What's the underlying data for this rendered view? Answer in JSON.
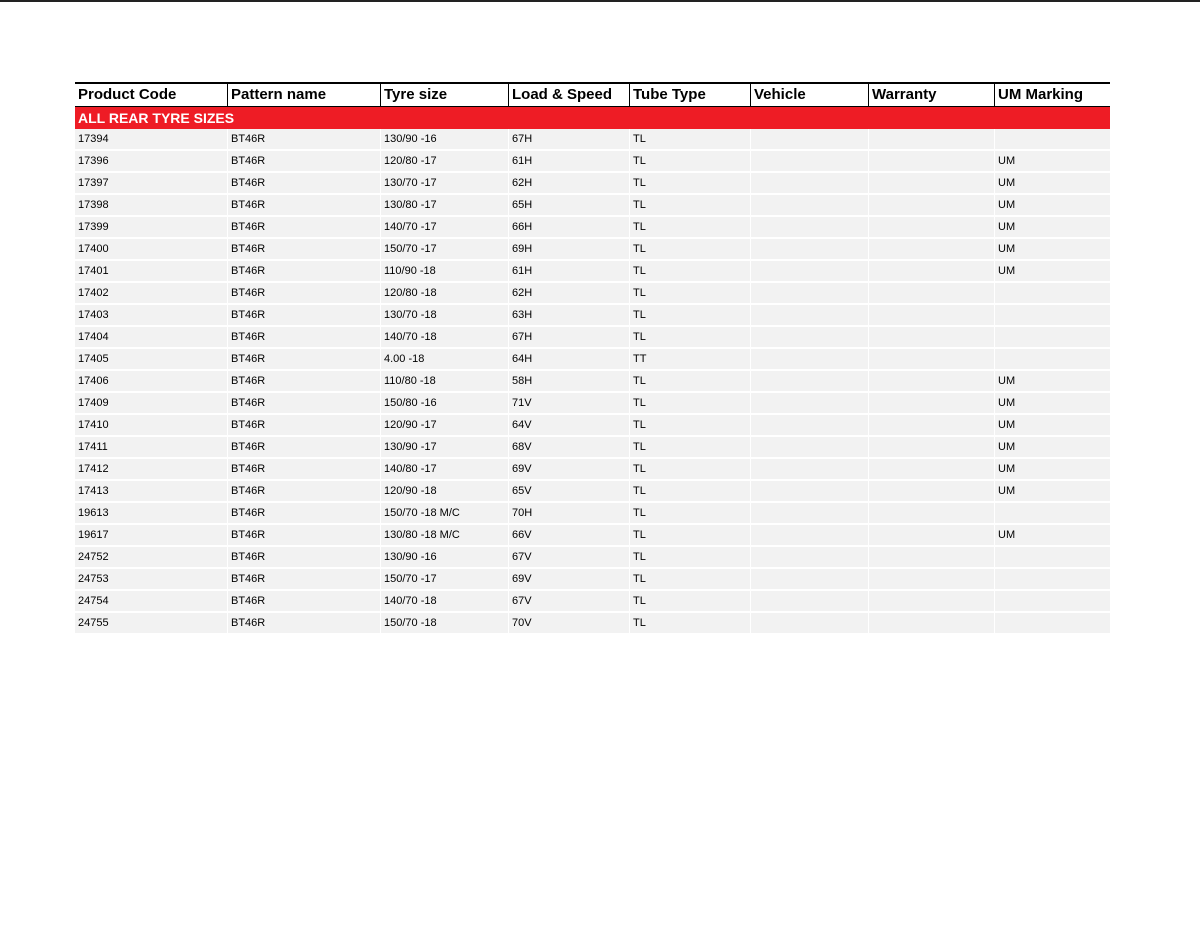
{
  "table": {
    "headers": [
      "Product Code",
      "Pattern name",
      "Tyre size",
      "Load & Speed",
      "Tube Type",
      "Vehicle",
      "Warranty",
      "UM Marking"
    ],
    "section_label": "ALL REAR TYRE SIZES",
    "rows": [
      [
        "17394",
        "BT46R",
        "130/90 -16",
        "67H",
        "TL",
        "",
        "",
        ""
      ],
      [
        "17396",
        "BT46R",
        "120/80 -17",
        "61H",
        "TL",
        "",
        "",
        "UM"
      ],
      [
        "17397",
        "BT46R",
        "130/70 -17",
        "62H",
        "TL",
        "",
        "",
        "UM"
      ],
      [
        "17398",
        "BT46R",
        "130/80 -17",
        "65H",
        "TL",
        "",
        "",
        "UM"
      ],
      [
        "17399",
        "BT46R",
        "140/70 -17",
        "66H",
        "TL",
        "",
        "",
        "UM"
      ],
      [
        "17400",
        "BT46R",
        "150/70 -17",
        "69H",
        "TL",
        "",
        "",
        "UM"
      ],
      [
        "17401",
        "BT46R",
        "110/90 -18",
        "61H",
        "TL",
        "",
        "",
        "UM"
      ],
      [
        "17402",
        "BT46R",
        "120/80 -18",
        "62H",
        "TL",
        "",
        "",
        ""
      ],
      [
        "17403",
        "BT46R",
        "130/70 -18",
        "63H",
        "TL",
        "",
        "",
        ""
      ],
      [
        "17404",
        "BT46R",
        "140/70 -18",
        "67H",
        "TL",
        "",
        "",
        ""
      ],
      [
        "17405",
        "BT46R",
        "4.00 -18",
        "64H",
        "TT",
        "",
        "",
        ""
      ],
      [
        "17406",
        "BT46R",
        "110/80 -18",
        "58H",
        "TL",
        "",
        "",
        "UM"
      ],
      [
        "17409",
        "BT46R",
        "150/80 -16",
        "71V",
        "TL",
        "",
        "",
        "UM"
      ],
      [
        "17410",
        "BT46R",
        "120/90 -17",
        "64V",
        "TL",
        "",
        "",
        "UM"
      ],
      [
        "17411",
        "BT46R",
        "130/90 -17",
        "68V",
        "TL",
        "",
        "",
        "UM"
      ],
      [
        "17412",
        "BT46R",
        "140/80 -17",
        "69V",
        "TL",
        "",
        "",
        "UM"
      ],
      [
        "17413",
        "BT46R",
        "120/90 -18",
        "65V",
        "TL",
        "",
        "",
        "UM"
      ],
      [
        "19613",
        "BT46R",
        "150/70 -18 M/C",
        "70H",
        "TL",
        "",
        "",
        ""
      ],
      [
        "19617",
        "BT46R",
        "130/80 -18 M/C",
        "66V",
        "TL",
        "",
        "",
        "UM"
      ],
      [
        "24752",
        "BT46R",
        "130/90 -16",
        "67V",
        "TL",
        "",
        "",
        ""
      ],
      [
        "24753",
        "BT46R",
        "150/70 -17",
        "69V",
        "TL",
        "",
        "",
        ""
      ],
      [
        "24754",
        "BT46R",
        "140/70 -18",
        "67V",
        "TL",
        "",
        "",
        ""
      ],
      [
        "24755",
        "BT46R",
        "150/70 -18",
        "70V",
        "TL",
        "",
        "",
        ""
      ]
    ]
  },
  "colors": {
    "section_bg": "#ee1c25",
    "row_bg": "#f2f2f2",
    "header_rule": "#000000"
  }
}
